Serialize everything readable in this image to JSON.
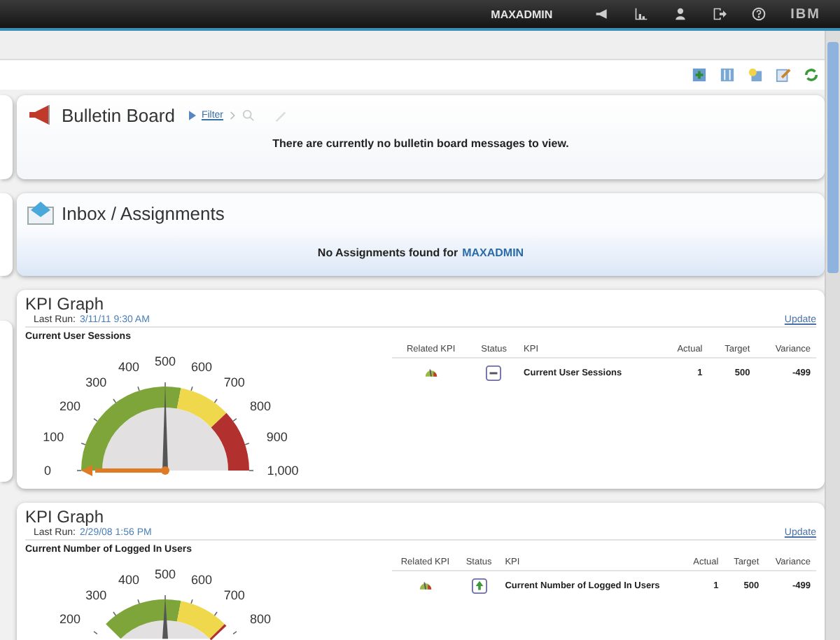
{
  "top_bar": {
    "user": "MAXADMIN",
    "logo": "IBM"
  },
  "bulletin_board": {
    "title": "Bulletin Board",
    "filter_link": "Filter",
    "message": "There are currently no bulletin board messages to view."
  },
  "inbox": {
    "title": "Inbox / Assignments",
    "message": "No Assignments found for",
    "user": "MAXADMIN"
  },
  "kpi_graphs": [
    {
      "title": "KPI Graph",
      "last_run_label": "Last Run:",
      "last_run": "3/11/11 9:30 AM",
      "update_link": "Update",
      "subtitle": "Current User Sessions",
      "gauge_ticks": [
        "0",
        "100",
        "200",
        "300",
        "400",
        "500",
        "600",
        "700",
        "800",
        "900",
        "1,000"
      ],
      "columns": [
        "Related KPI",
        "Status",
        "KPI",
        "Actual",
        "Target",
        "Variance"
      ],
      "rows": [
        {
          "kind": "neutral",
          "kpi": "Current User Sessions",
          "actual": "1",
          "target": "500",
          "variance": "-499"
        }
      ]
    },
    {
      "title": "KPI Graph",
      "last_run_label": "Last Run:",
      "last_run": "2/29/08 1:56 PM",
      "update_link": "Update",
      "subtitle": "Current Number of Logged In Users",
      "gauge_ticks": [
        "200",
        "300",
        "400",
        "500",
        "600",
        "700",
        "800"
      ],
      "columns": [
        "Related KPI",
        "Status",
        "KPI",
        "Actual",
        "Target",
        "Variance"
      ],
      "rows": [
        {
          "kind": "up",
          "kpi": "Current Number of Logged In Users",
          "actual": "1",
          "target": "500",
          "variance": "-499"
        }
      ]
    }
  ]
}
